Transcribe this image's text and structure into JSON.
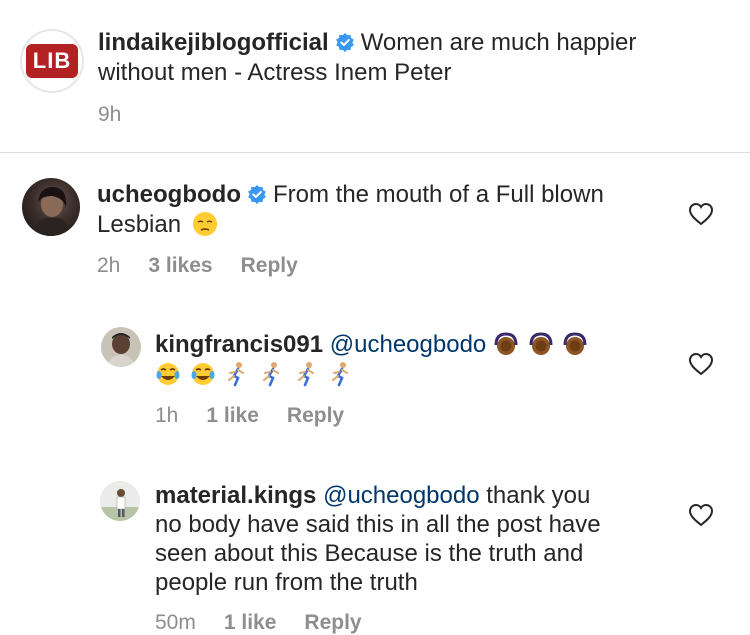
{
  "caption": {
    "username": "lindaikejiblogofficial",
    "text_line1": "Women are much happier",
    "text_line2": "without men - Actress Inem Peter",
    "logo_text": "LIB",
    "time": "9h"
  },
  "comments": [
    {
      "username": "ucheogbodo",
      "text_line1": "From the mouth of a Full blown",
      "text_line2": "Lesbian",
      "time": "2h",
      "likes": "3 likes",
      "reply_label": "Reply"
    },
    {
      "username": "kingfrancis091",
      "mention": "@ucheogbodo",
      "time": "1h",
      "likes": "1 like",
      "reply_label": "Reply"
    },
    {
      "username": "material.kings",
      "mention": "@ucheogbodo",
      "text_line1": "thank you",
      "text_line2": "no body have said this in all the post have",
      "text_line3": "seen about this  Because is the truth and",
      "text_line4": "people run from the truth",
      "time": "50m",
      "likes": "1 like",
      "reply_label": "Reply"
    }
  ],
  "icons": {
    "verified": "verified-badge-icon",
    "like": "heart-icon",
    "unamused": "unamused-face-emoji",
    "laugh": "tears-of-joy-emoji",
    "gesture": "person-gesturing-ok-emoji",
    "runner": "person-running-emoji"
  },
  "colors": {
    "text": "#262626",
    "meta": "#8e8e8e",
    "verified": "#3897f0",
    "logo": "#b22222",
    "mention": "#00376b"
  }
}
